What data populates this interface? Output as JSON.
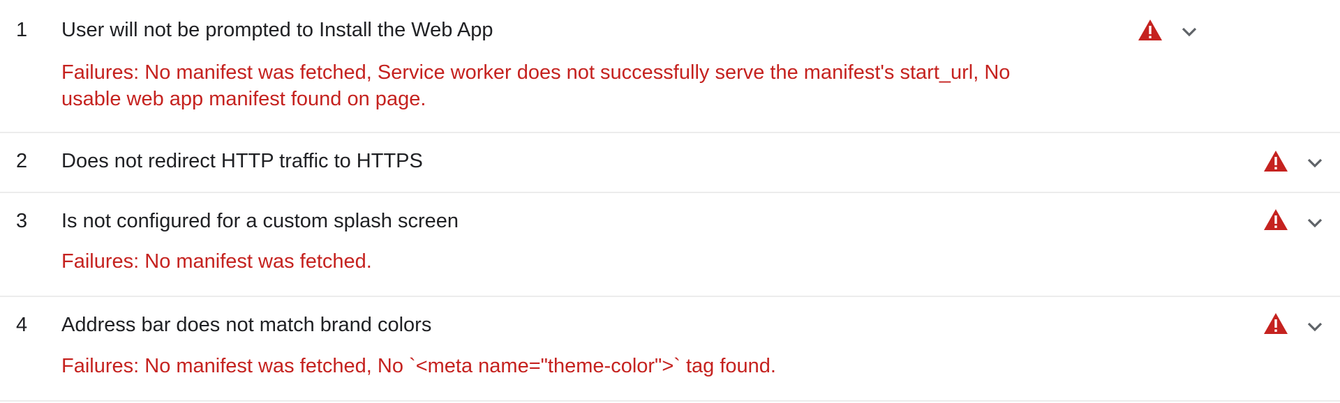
{
  "audits": [
    {
      "index": "1",
      "title": "User will not be prompted to Install the Web App",
      "failure": "Failures: No manifest was fetched, Service worker does not successfully serve the manifest's start_url, No usable web app manifest found on page.",
      "status_icon": "warning-triangle-icon",
      "toggle_icon": "chevron-down-icon"
    },
    {
      "index": "2",
      "title": "Does not redirect HTTP traffic to HTTPS",
      "failure": "",
      "status_icon": "warning-triangle-icon",
      "toggle_icon": "chevron-down-icon"
    },
    {
      "index": "3",
      "title": "Is not configured for a custom splash screen",
      "failure": "Failures: No manifest was fetched.",
      "status_icon": "warning-triangle-icon",
      "toggle_icon": "chevron-down-icon"
    },
    {
      "index": "4",
      "title": "Address bar does not match brand colors",
      "failure": "Failures: No manifest was fetched, No `<meta name=\"theme-color\">` tag found.",
      "status_icon": "warning-triangle-icon",
      "toggle_icon": "chevron-down-icon"
    }
  ],
  "colors": {
    "failure_text": "#c5221f",
    "warning_icon": "#c5221f",
    "divider": "#ececec",
    "title_text": "#202124"
  }
}
